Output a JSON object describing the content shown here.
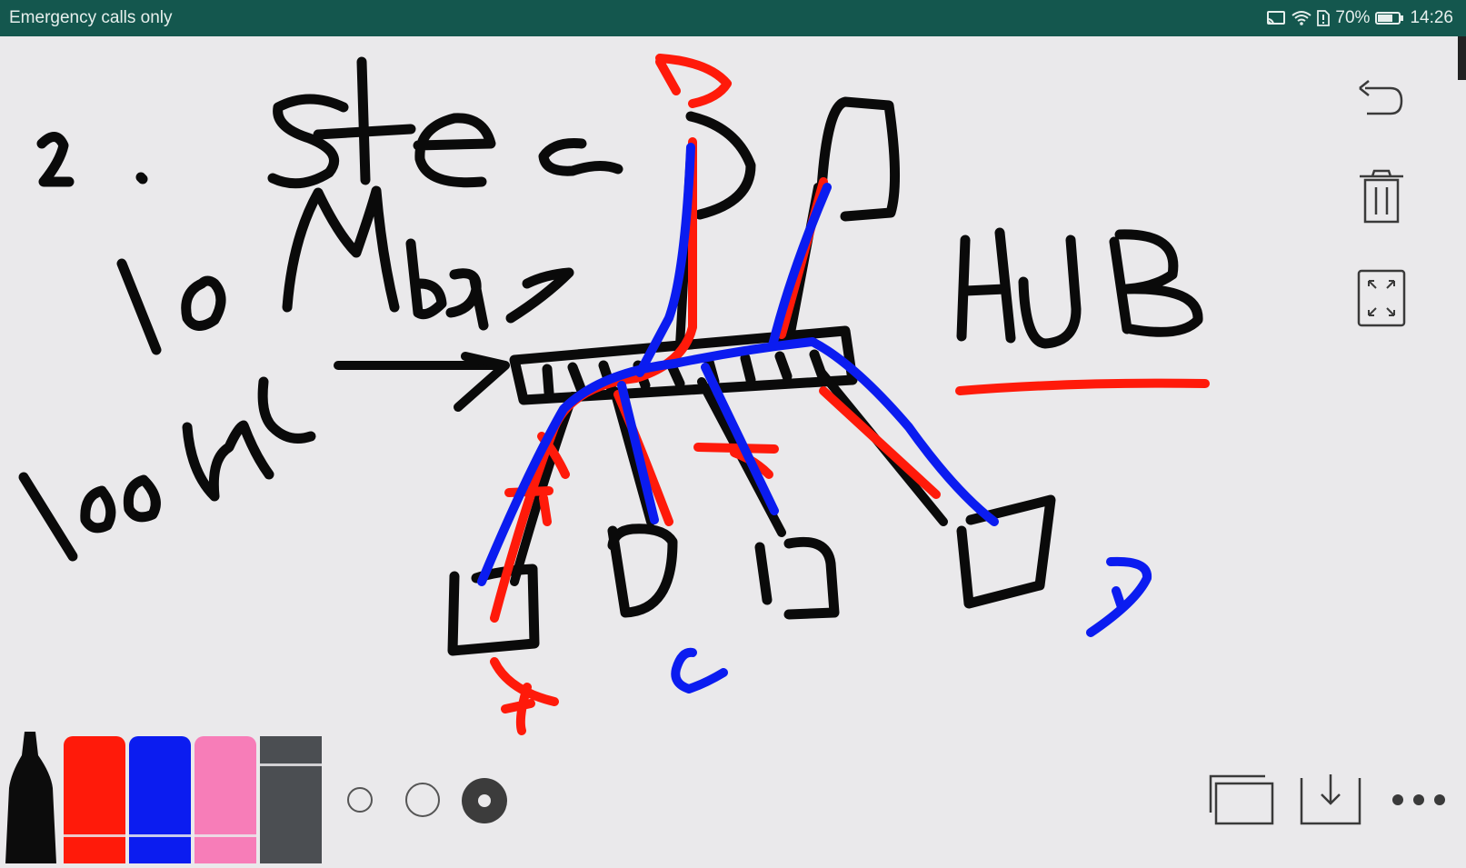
{
  "statusbar": {
    "carrier_text": "Emergency calls only",
    "battery_percent": "70%",
    "time": "14:26",
    "icons": [
      "cast-icon",
      "wifi-icon",
      "sim-alert-icon",
      "battery-icon"
    ]
  },
  "toolbar_right": {
    "buttons": [
      "undo-icon",
      "trash-icon",
      "expand-icon"
    ]
  },
  "palette": {
    "tool": "marker-icon",
    "colors": [
      {
        "name": "red",
        "hex": "#ff1a0a"
      },
      {
        "name": "blue",
        "hex": "#0b1cf0"
      },
      {
        "name": "pink",
        "hex": "#f77db8"
      },
      {
        "name": "gray",
        "hex": "#4b4e52"
      }
    ],
    "stroke_sizes": [
      "small",
      "medium",
      "large"
    ],
    "selected_size": "large"
  },
  "bottom_actions": [
    "pages-icon",
    "save-icon",
    "more-icon"
  ],
  "colors": {
    "ink_black": "#0a0a0a",
    "ink_red": "#ff1a0a",
    "ink_blue": "#0b1cf0",
    "status_bg": "#14574e",
    "canvas_bg": "#eae9eb"
  }
}
